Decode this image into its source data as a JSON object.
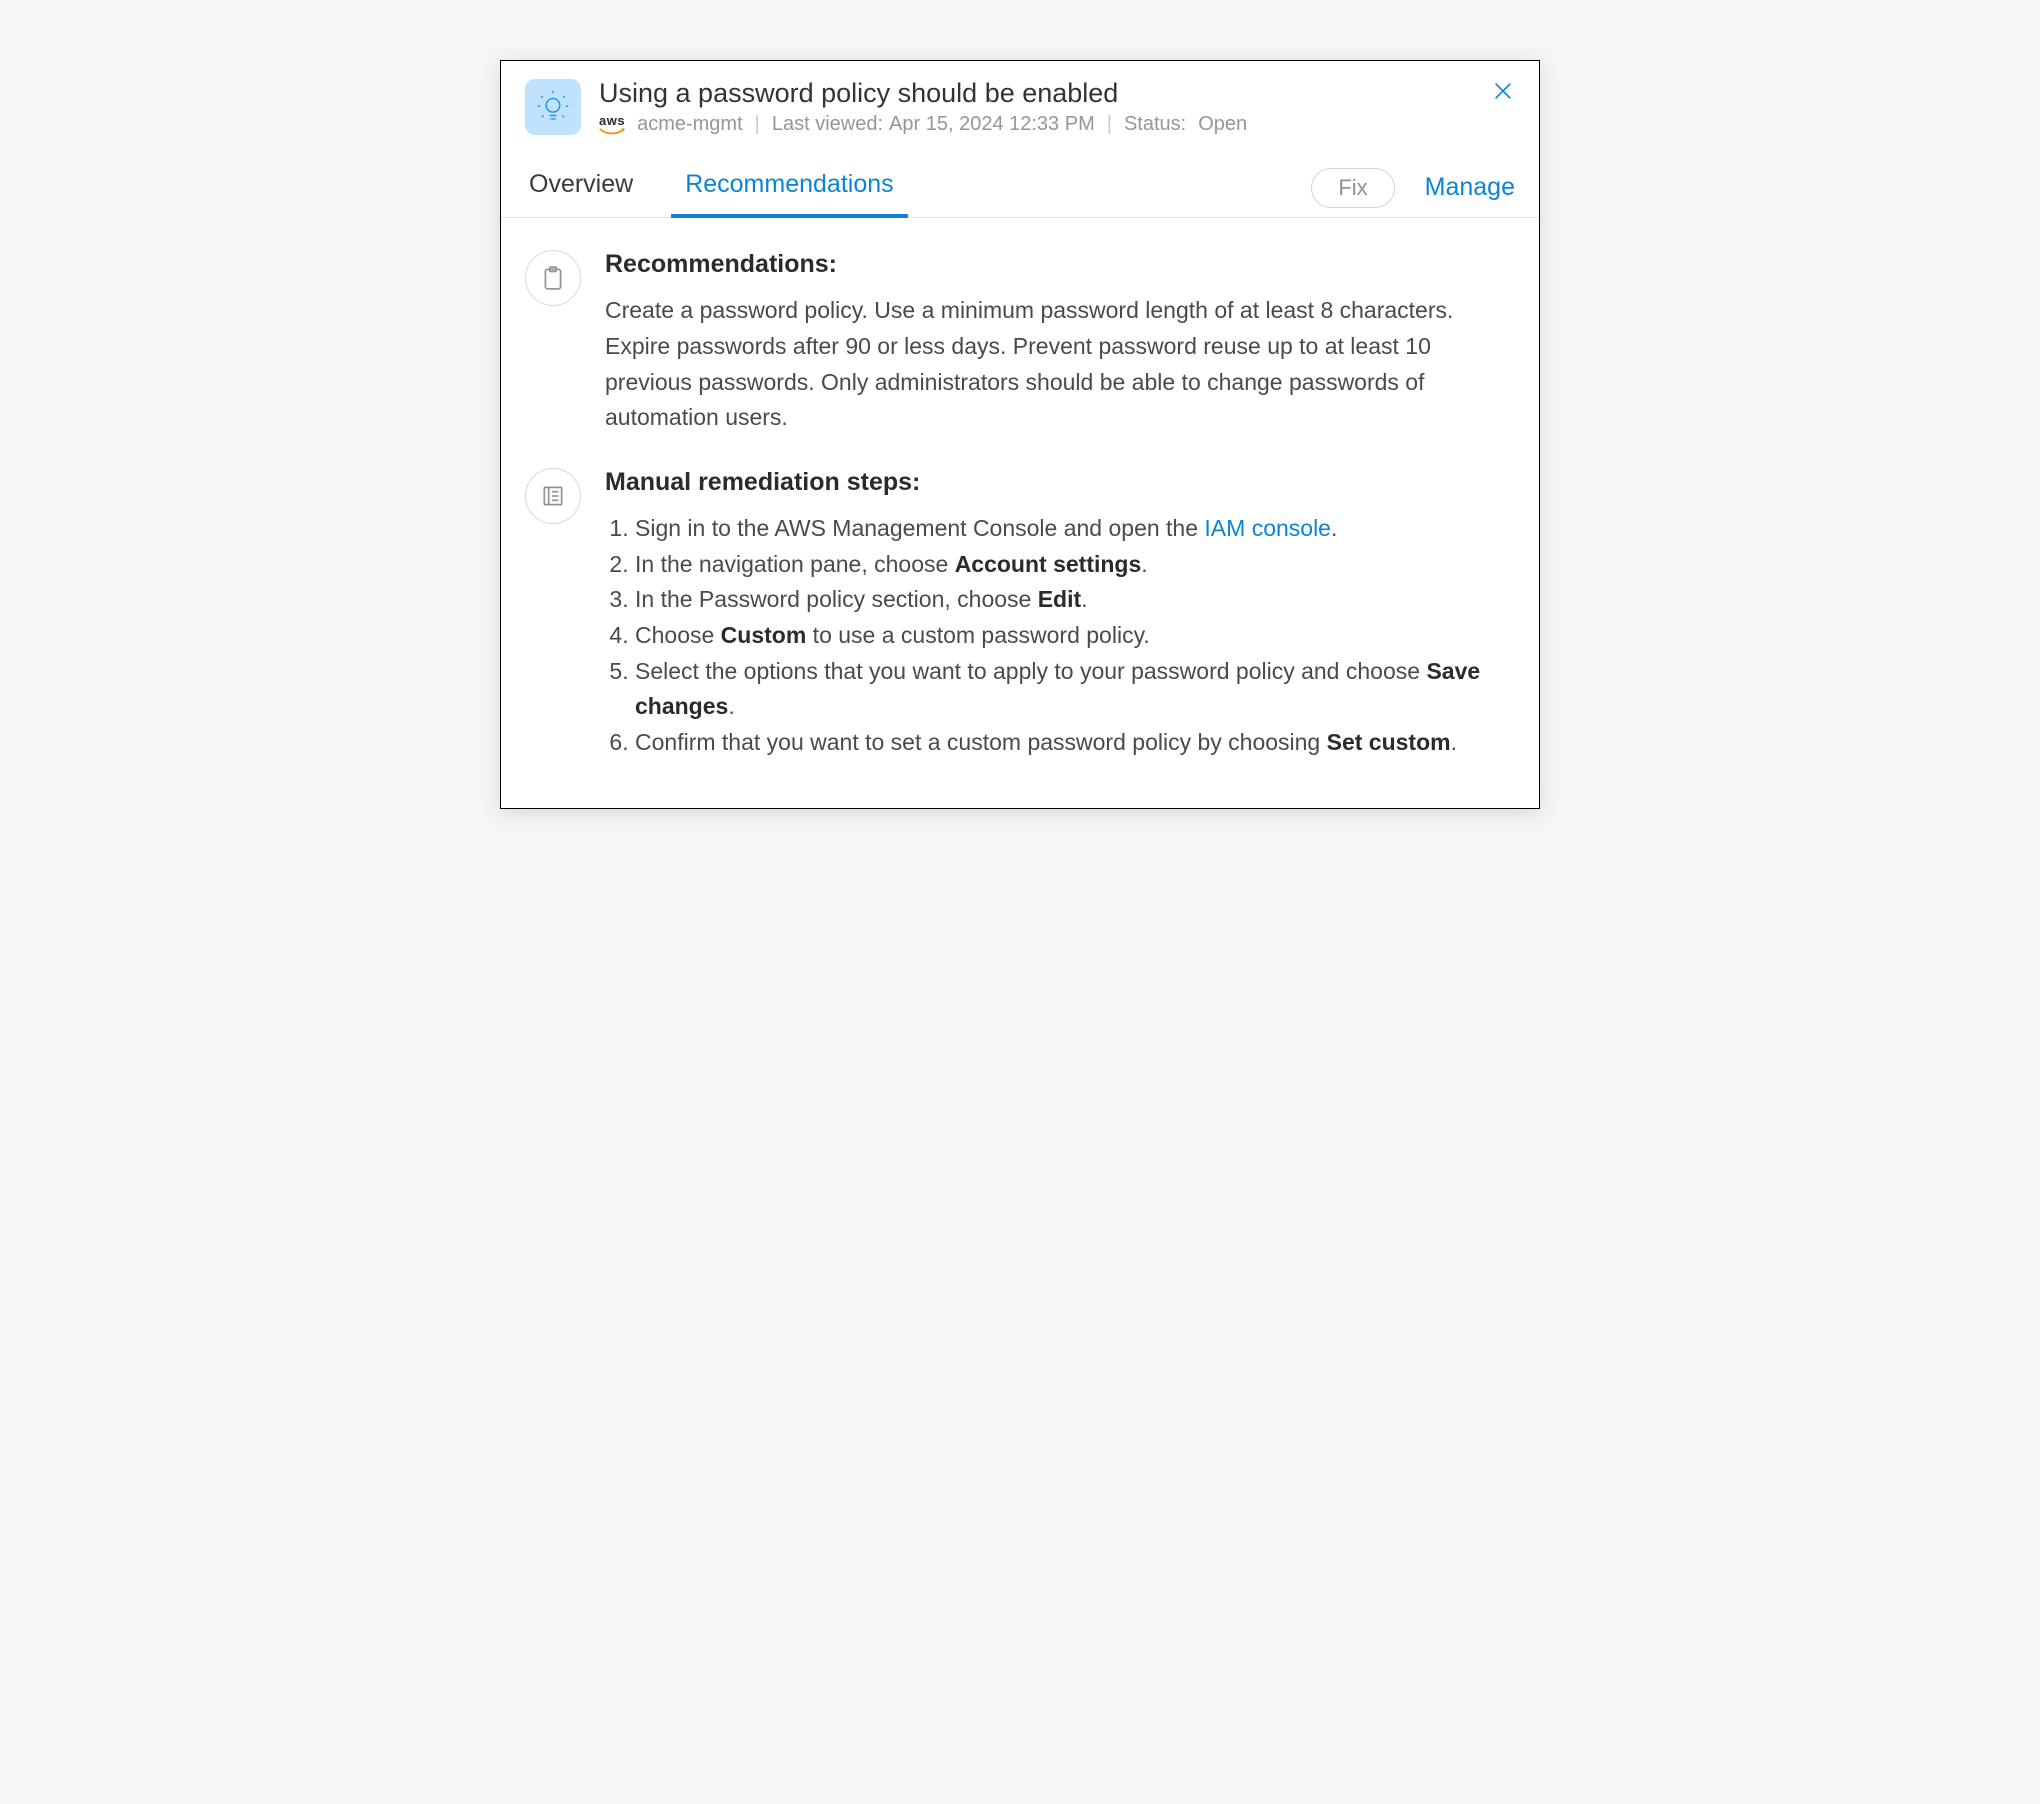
{
  "header": {
    "title": "Using a password policy should be enabled",
    "provider_label": "aws",
    "account": "acme-mgmt",
    "last_viewed_label": "Last viewed:",
    "last_viewed_value": "Apr 15, 2024 12:33 PM",
    "status_label": "Status:",
    "status_value": "Open"
  },
  "tabs": [
    {
      "id": "overview",
      "label": "Overview",
      "active": false
    },
    {
      "id": "recommendations",
      "label": "Recommendations",
      "active": true
    }
  ],
  "actions": {
    "fix_label": "Fix",
    "manage_label": "Manage"
  },
  "recommendations": {
    "heading": "Recommendations:",
    "text": "Create a password policy. Use a minimum password length of at least 8 characters. Expire passwords after 90 or less days. Prevent password reuse up to at least 10 previous passwords. Only administrators should be able to change passwords of automation users."
  },
  "remediation": {
    "heading": "Manual remediation steps:",
    "steps": [
      {
        "prefix": "Sign in to the AWS Management Console and open the ",
        "link_text": "IAM console",
        "suffix": "."
      },
      {
        "prefix": "In the navigation pane, choose ",
        "bold": "Account settings",
        "suffix": "."
      },
      {
        "prefix": "In the Password policy section, choose ",
        "bold": "Edit",
        "suffix": "."
      },
      {
        "prefix": "Choose ",
        "bold": "Custom",
        "suffix": " to use a custom password policy."
      },
      {
        "prefix": "Select the options that you want to apply to your password policy and choose ",
        "bold": "Save changes",
        "suffix": "."
      },
      {
        "prefix": "Confirm that you want to set a custom password policy by choosing ",
        "bold": "Set custom",
        "suffix": "."
      }
    ]
  }
}
